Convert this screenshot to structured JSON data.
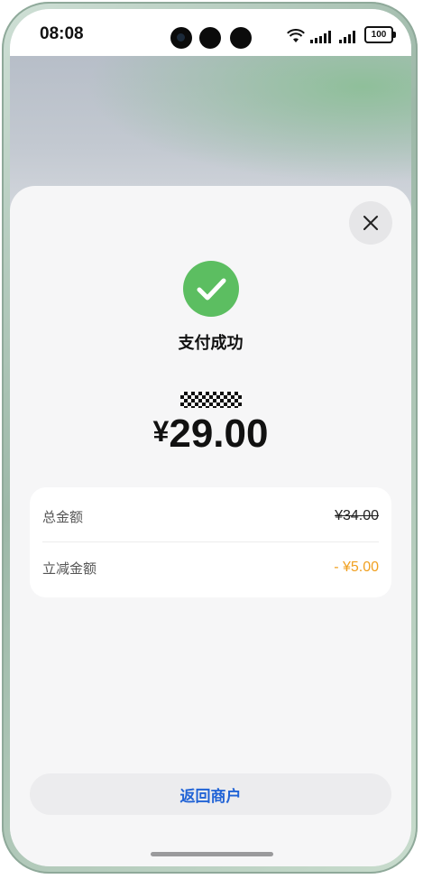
{
  "status_bar": {
    "time": "08:08",
    "battery": "100"
  },
  "payment": {
    "title": "支付成功",
    "currency": "¥",
    "amount": "29.00"
  },
  "details": {
    "rows": [
      {
        "label": "总金额",
        "value": "¥34.00"
      },
      {
        "label": "立减金额",
        "value": "- ¥5.00"
      }
    ]
  },
  "actions": {
    "return_label": "返回商户"
  },
  "icons": {
    "close": "close-icon",
    "success": "checkmark-icon",
    "wifi": "wifi-icon",
    "signal": "signal-icon",
    "battery": "battery-icon"
  },
  "colors": {
    "success_green": "#5cbe61",
    "discount_orange": "#f0a020",
    "link_blue": "#2163d6"
  }
}
